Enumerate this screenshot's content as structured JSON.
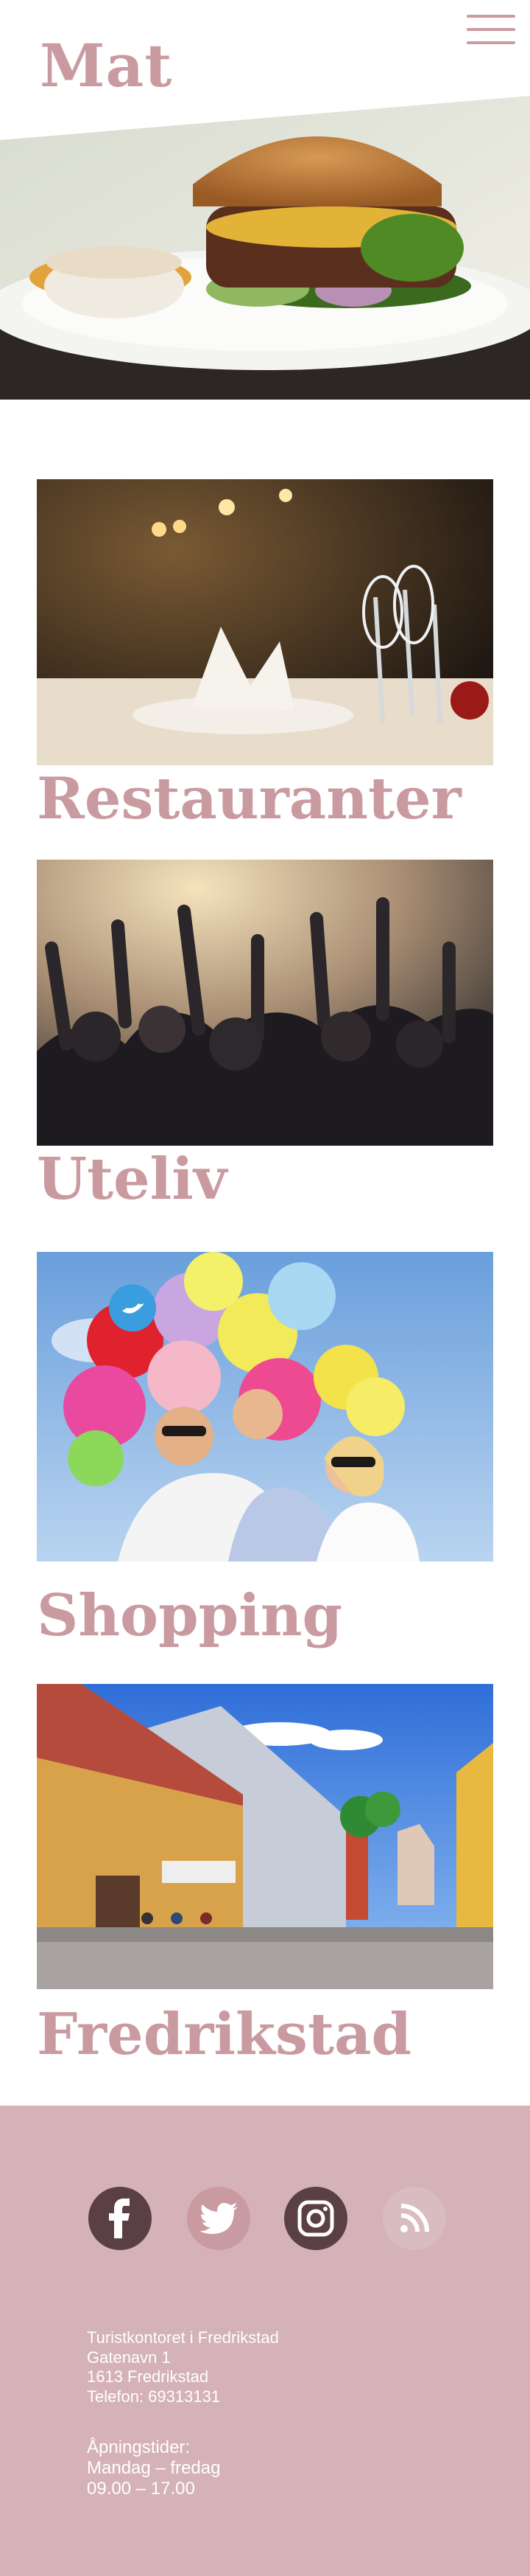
{
  "header": {
    "title": "Mat",
    "menu_icon": "hamburger-menu-icon"
  },
  "categories": [
    {
      "title": "Restauranter",
      "image": "restaurant-table-photo"
    },
    {
      "title": "Uteliv",
      "image": "concert-crowd-photo"
    },
    {
      "title": "Shopping",
      "image": "family-balloons-photo"
    },
    {
      "title": "Fredrikstad",
      "image": "old-town-street-photo"
    }
  ],
  "footer": {
    "social": [
      {
        "name": "facebook-icon"
      },
      {
        "name": "twitter-icon"
      },
      {
        "name": "instagram-icon"
      },
      {
        "name": "rss-icon"
      }
    ],
    "address": {
      "org": "Turistkontoret i Fredrikstad",
      "street": "Gatenavn 1",
      "postal": "1613 Fredrikstad",
      "phone": "Telefon: 69313131"
    },
    "hours": {
      "heading": "Åpningstider:",
      "days": "Mandag – fredag",
      "time": "09.00 – 17.00"
    }
  },
  "colors": {
    "accent": "#c99ba0",
    "footer_bg": "#d4b2b7",
    "social_dark": "#5a3f44"
  }
}
